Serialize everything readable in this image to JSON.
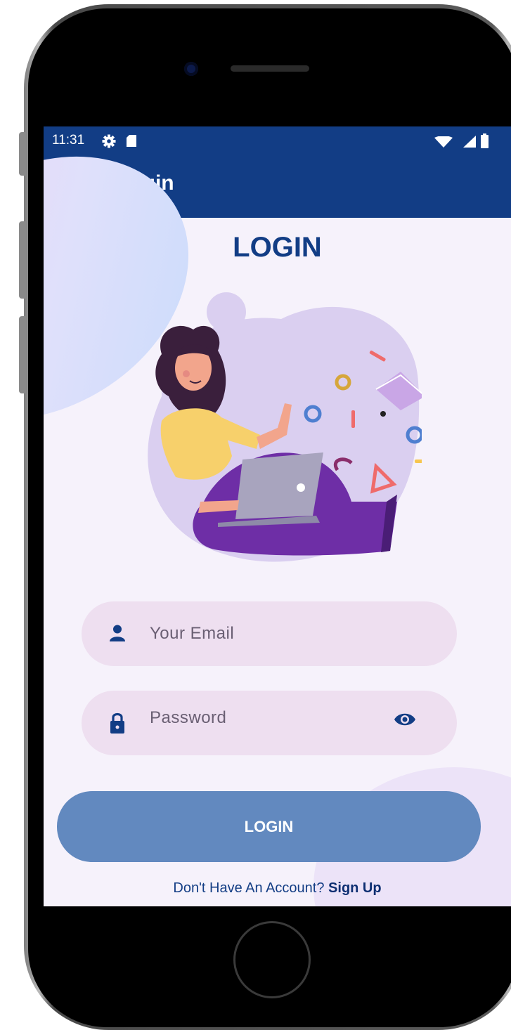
{
  "status_bar": {
    "time": "11:31",
    "icons": [
      "settings-icon",
      "sd-card-icon",
      "wifi-icon",
      "signal-icon",
      "battery-icon"
    ]
  },
  "app_bar": {
    "back_icon": "arrow-left-icon",
    "title": "Login"
  },
  "main": {
    "heading": "LOGIN",
    "email_field": {
      "placeholder": "Your Email",
      "icon": "person-icon"
    },
    "password_field": {
      "placeholder": "Password",
      "icon": "lock-icon",
      "toggle_icon": "eye-icon"
    },
    "login_button": "LOGIN",
    "signup_prompt": "Don't Have An Account?",
    "signup_link": "Sign Up"
  },
  "colors": {
    "app_bar": "#123d85",
    "background": "#f6f2fb",
    "input_fill": "#eedff0",
    "button": "#6289bf",
    "accent_purple": "#6e2ea6"
  }
}
